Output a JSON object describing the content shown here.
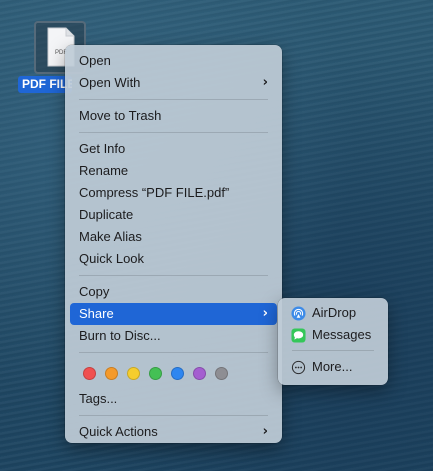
{
  "desktop": {
    "file_label": "PDF FILE.pdf",
    "file_icon_text": "PDF",
    "file_icon": "pdf-document-icon"
  },
  "context_menu": {
    "groups": [
      [
        "Open",
        "Open With"
      ],
      [
        "Move to Trash"
      ],
      [
        "Get Info",
        "Rename",
        "Compress “PDF FILE.pdf”",
        "Duplicate",
        "Make Alias",
        "Quick Look"
      ],
      [
        "Copy",
        "Share",
        "Burn to Disc..."
      ]
    ],
    "open": "Open",
    "open_with": "Open With",
    "move_to_trash": "Move to Trash",
    "get_info": "Get Info",
    "rename": "Rename",
    "compress": "Compress “PDF FILE.pdf”",
    "duplicate": "Duplicate",
    "make_alias": "Make Alias",
    "quick_look": "Quick Look",
    "copy": "Copy",
    "share": "Share",
    "burn": "Burn to Disc...",
    "tags": "Tags...",
    "quick_actions": "Quick Actions",
    "submenu_chevron": "›",
    "tag_colors": [
      "#f05050",
      "#f59a2b",
      "#f5cd2e",
      "#44c055",
      "#2e86f0",
      "#a45ed0",
      "#8e8e93"
    ],
    "highlighted": "Share"
  },
  "share_submenu": {
    "airdrop": "AirDrop",
    "messages": "Messages",
    "more": "More...",
    "icons": [
      "airdrop-icon",
      "messages-icon",
      "more-icon"
    ]
  },
  "colors": {
    "highlight": "#1f66d6",
    "menu_bg": "#bccad6"
  }
}
